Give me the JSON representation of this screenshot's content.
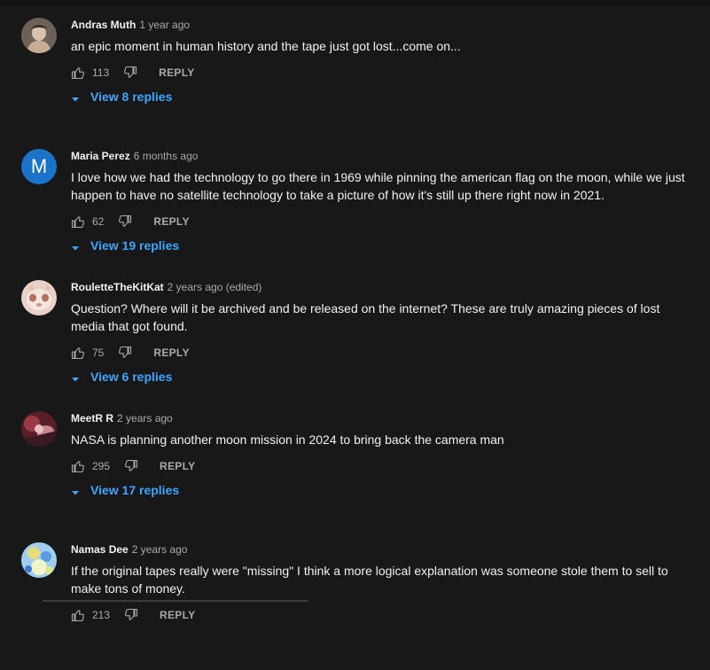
{
  "comments": [
    {
      "author": "Andras Muth",
      "time": "1 year ago",
      "text": "an epic moment in human history and the tape just got lost...come on...",
      "likes": "113",
      "reply_label": "REPLY",
      "view_replies": "View 8 replies",
      "avatar": {
        "type": "photo",
        "colors": [
          "#8a7a6e",
          "#d8c6b6",
          "#4a3a30"
        ]
      }
    },
    {
      "author": "Maria Perez",
      "time": "6 months ago",
      "text": "I love how we had the technology to go there in 1969 while pinning the american flag on the moon, while we just happen to have no satellite technology to take a picture of how it's still up there right now in 2021.",
      "likes": "62",
      "reply_label": "REPLY",
      "view_replies": "View 19 replies",
      "avatar": {
        "type": "letter",
        "letter": "M",
        "color": "#1a73c8"
      }
    },
    {
      "author": "RouletteTheKitKat",
      "time": "2 years ago (edited)",
      "text": "Question? Where will it be archived and be released on the internet? These are truly amazing pieces of lost media that got found.",
      "likes": "75",
      "reply_label": "REPLY",
      "view_replies": "View 6 replies",
      "avatar": {
        "type": "photo",
        "colors": [
          "#f2e4dc",
          "#e8b8a8",
          "#c89080"
        ]
      }
    },
    {
      "author": "MeetR R",
      "time": "2 years ago",
      "text": "NASA is planning another moon mission in 2024 to bring back the camera man",
      "likes": "295",
      "reply_label": "REPLY",
      "view_replies": "View 17 replies",
      "avatar": {
        "type": "photo",
        "colors": [
          "#7a2630",
          "#c88a90",
          "#3a1a20"
        ]
      }
    },
    {
      "author": "Namas Dee",
      "time": "2 years ago",
      "text": "If the original tapes really were \"missing\" I think a more logical explanation was someone stole them to sell to make tons of money.",
      "likes": "213",
      "reply_label": "REPLY",
      "avatar": {
        "type": "photo",
        "colors": [
          "#4a90d8",
          "#e8d870",
          "#b8e0f8"
        ]
      }
    }
  ],
  "icons": {
    "like": "thumbs-up-outline",
    "dislike": "thumbs-down-outline",
    "expand": "caret-down"
  },
  "colors": {
    "background": "#181818",
    "link": "#3ea6ff",
    "secondary_text": "#aaaaaa",
    "primary_text": "#f1f1f1"
  }
}
